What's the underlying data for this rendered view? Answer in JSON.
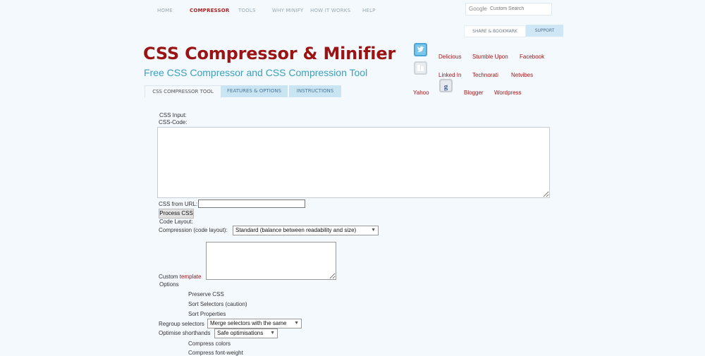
{
  "nav": [
    "HOME",
    "COMPRESSOR",
    "TOOLS",
    "WHY MINIFY",
    "HOW IT WORKS",
    "HELP"
  ],
  "search": {
    "logo": "Google",
    "placeholder": "Custom Search"
  },
  "header_buttons": {
    "share": "SHARE & BOOKMARK",
    "support": "SUPPORT"
  },
  "title": "CSS Compressor & Minifier",
  "subtitle": "Free CSS Compressor and CSS Compression Tool",
  "tabs": [
    "CSS COMPRESSOR TOOL",
    "FEATURES & OPTIONS",
    "INSTRUCTIONS"
  ],
  "social": {
    "icons": [
      "twitter-icon",
      "digg-icon",
      "google-icon"
    ],
    "links": [
      "Delicious",
      "Stumble Upon",
      "Facebook",
      "Linked In",
      "Technorati",
      "Netvibes",
      "Yahoo",
      "Blogger",
      "Wordpress"
    ]
  },
  "form": {
    "css_input_label": "CSS Input:",
    "css_code_label": "CSS-Code:",
    "css_url_label": "CSS from URL:",
    "process_button": "Process CSS",
    "code_layout_label": "Code Layout:",
    "compression_label": "Compression (code layout):",
    "compression_value": "Standard (balance between readability and size)",
    "custom_label": "Custom",
    "template_link": "template",
    "options_label": "Options",
    "preserve_css": "Preserve CSS",
    "sort_selectors": "Sort Selectors (caution)",
    "sort_properties": "Sort Properties",
    "regroup_label": "Regroup selectors",
    "regroup_value": "Merge selectors with the same",
    "shorthands_label": "Optimise shorthands",
    "shorthands_value": "Safe optimisations",
    "compress_colors": "Compress colors",
    "compress_font_weight": "Compress font-weight"
  },
  "colors": {
    "brand_red": "#9b1414",
    "subtitle_blue": "#3aa0bf",
    "tab_blue": "#c9e4f3",
    "background": "#f3f9fd"
  }
}
